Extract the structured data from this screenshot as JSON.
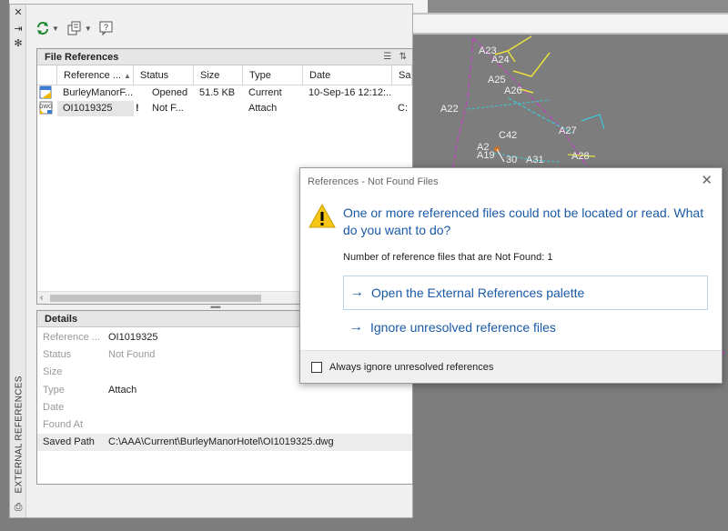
{
  "palette": {
    "title": "EXTERNAL REFERENCES",
    "file_references": {
      "header": "File References",
      "columns": [
        "Reference ...",
        "Status",
        "Size",
        "Type",
        "Date",
        "Sa"
      ],
      "rows": [
        {
          "name": "BurleyManorF...",
          "status": "Opened",
          "size": "51.5 KB",
          "type": "Current",
          "date": "10-Sep-16 12:12:...",
          "saved": ""
        },
        {
          "name": "OI1019325",
          "flag": "!",
          "status": "Not F...",
          "size": "",
          "type": "Attach",
          "date": "",
          "saved": "C:"
        }
      ]
    },
    "details": {
      "header": "Details",
      "rows": [
        {
          "label": "Reference ...",
          "value": "OI1019325"
        },
        {
          "label": "Status",
          "value": "Not Found"
        },
        {
          "label": "Size",
          "value": ""
        },
        {
          "label": "Type",
          "value": "Attach"
        },
        {
          "label": "Date",
          "value": ""
        },
        {
          "label": "Found At",
          "value": ""
        },
        {
          "label": "Saved Path",
          "value": "C:\\AAA\\Current\\BurleyManorHotel\\OI1019325.dwg"
        }
      ]
    }
  },
  "dialog": {
    "title": "References - Not Found Files",
    "main_instruction": "One or more referenced files could not be located or read. What do you want to do?",
    "count_text": "Number of reference files that are Not Found: 1",
    "option_open": "Open the External References palette",
    "option_ignore": "Ignore unresolved reference files",
    "checkbox_label": "Always ignore unresolved references",
    "close_symbol": "✕",
    "arrow_symbol": "→"
  },
  "drawing_labels": {
    "a23": "A23",
    "a24": "A24",
    "a25": "A25",
    "a26": "A26",
    "a22": "A22",
    "a27": "A27",
    "c42": "C42",
    "a2": "A2",
    "a19": "A19",
    "a31": "A31",
    "a28": "A28",
    "a30": "30"
  },
  "colors": {
    "accent_blue": "#1a5aa6",
    "warning_yellow": "#f5c518",
    "canvas_gray": "#7d7d7d"
  }
}
